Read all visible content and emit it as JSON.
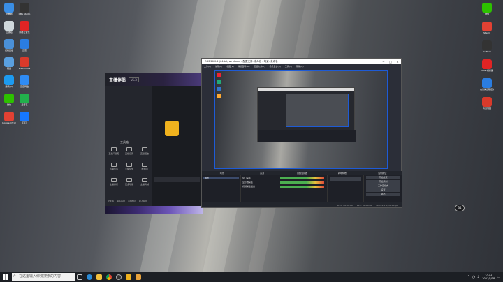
{
  "taskbar": {
    "search_placeholder": "在这里输入你要搜索的内容",
    "time": "10:04",
    "date": "2021/5/18"
  },
  "desktop": {
    "left_labels": [
      "此电脑",
      "回收站",
      "控制面板",
      "网络",
      "腾讯QQ",
      "微信",
      "Google Chrome",
      "OBS Studio",
      "网易云音乐",
      "迅雷",
      "WPS Office",
      "百度网盘",
      "爱奇艺",
      "钉钉"
    ],
    "right_labels": [
      "微信",
      "Steam",
      "NetEase",
      "MuMu模拟器",
      "向日葵远程控制",
      "有道词典"
    ]
  },
  "app": {
    "logo": "直播伴侣",
    "version": "v5.3",
    "menu_title": "工具箱",
    "side_tiles": [
      "直播间管理",
      "直播日历",
      "直播回放",
      "直播加速",
      "主播任务",
      "粉丝团",
      "主播排行",
      "更多功能",
      "主播商城"
    ],
    "bottom_links": [
      "企业版",
      "联系客服",
      "直播规范",
      "新人指导"
    ]
  },
  "obs": {
    "title": "OBS 26.0.2 (64-bit, windows) - 配置文件: 未命名 - 场景: 未命名",
    "menu": [
      "文件(F)",
      "编辑(E)",
      "视图(V)",
      "停靠部件(D)",
      "配置文件(P)",
      "场景集合(S)",
      "工具(T)",
      "帮助(H)"
    ],
    "docks": [
      "场景",
      "来源",
      "音频混音器",
      "转场特效",
      "控制按钮"
    ],
    "scenes": [
      "场景"
    ],
    "sources": [
      "窗口采集",
      "显示器采集",
      "视频采集设备"
    ],
    "controls": [
      "开始推流",
      "开始录制",
      "工作室模式",
      "设置",
      "退出"
    ],
    "status": [
      "LIVE: 00:00:00",
      "REC: 00:00:00",
      "CPU: 2.6%, 30.00 fps"
    ]
  },
  "badge": "34"
}
